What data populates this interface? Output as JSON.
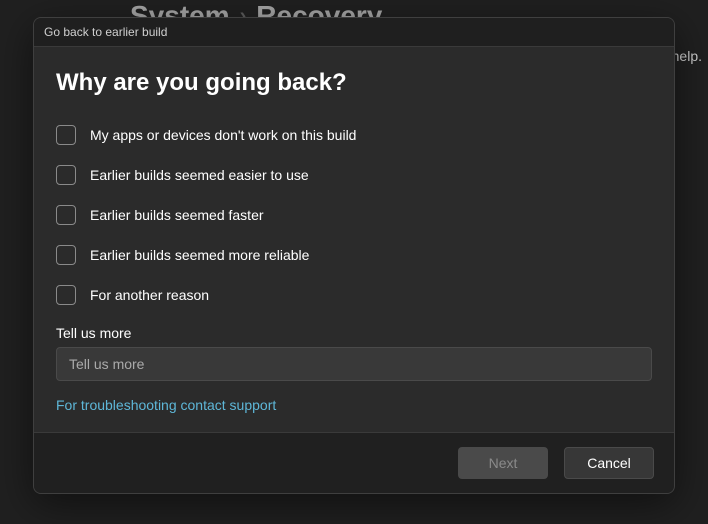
{
  "breadcrumb": {
    "parent": "System",
    "current": "Recovery"
  },
  "background": {
    "help_fragment": "help."
  },
  "modal": {
    "titlebar": "Go back to earlier build",
    "heading": "Why are you going back?",
    "reasons": [
      "My apps or devices don't work on this build",
      "Earlier builds seemed easier to use",
      "Earlier builds seemed faster",
      "Earlier builds seemed more reliable",
      "For another reason"
    ],
    "tell_us_more_label": "Tell us more",
    "tell_us_more_placeholder": "Tell us more",
    "support_link": "For troubleshooting contact support",
    "buttons": {
      "next": "Next",
      "cancel": "Cancel"
    }
  }
}
